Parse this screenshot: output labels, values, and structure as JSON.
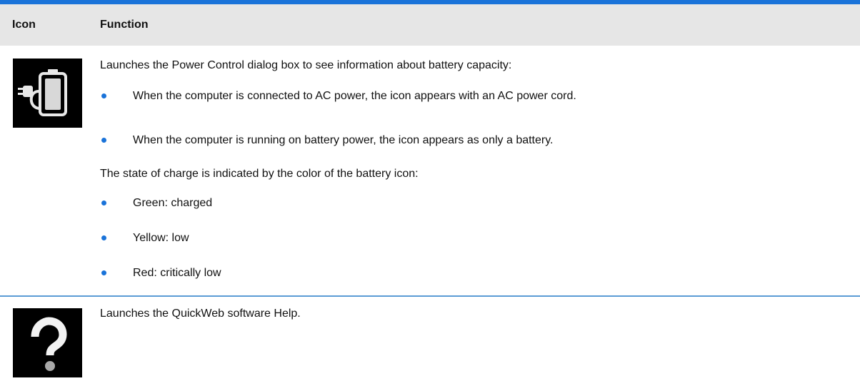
{
  "table": {
    "headers": {
      "icon": "Icon",
      "function": "Function"
    },
    "rows": [
      {
        "icon": "battery-power-icon",
        "intro": "Launches the Power Control dialog box to see information about battery capacity:",
        "bullets_a": [
          "When the computer is connected to AC power, the icon appears with an AC power cord.",
          "When the computer is running on battery power, the icon appears as only a battery."
        ],
        "middle": "The state of charge is indicated by the color of the battery icon:",
        "bullets_b": [
          "Green: charged",
          "Yellow: low",
          "Red: critically low"
        ]
      },
      {
        "icon": "question-mark-icon",
        "intro": "Launches the QuickWeb software Help."
      }
    ]
  },
  "colors": {
    "accent": "#1a73d9",
    "header_bg": "#e6e6e6",
    "divider": "#5b9bd5",
    "icon_bg": "#000000"
  }
}
